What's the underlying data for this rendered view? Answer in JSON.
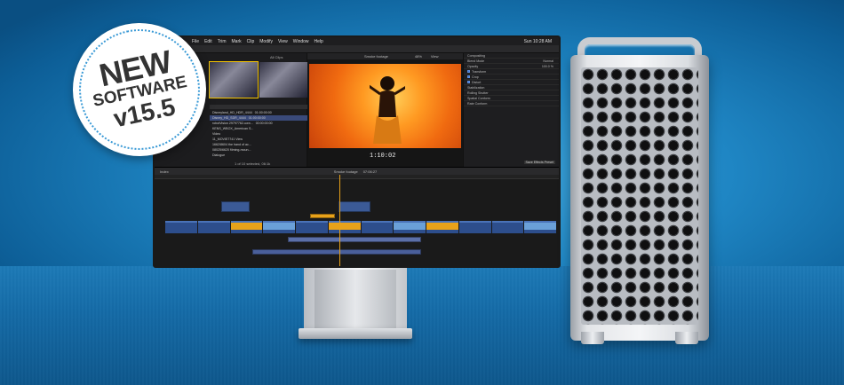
{
  "badge": {
    "line1": "NEW",
    "line2": "SOFTWARE",
    "line3": "v15.5"
  },
  "menu": {
    "items": [
      "File",
      "Edit",
      "Trim",
      "Mark",
      "Clip",
      "Modify",
      "View",
      "Window",
      "Help"
    ],
    "clock": "Sun 10:28 AM"
  },
  "browser": {
    "filter": "All Clips",
    "clips": [
      {
        "name": "Disneyland_HD_HDR_4444",
        "start": "01:00:00:00",
        "end": "01:00:0"
      },
      {
        "name": "Disney_HD_SDR_4444",
        "start": "01:00:00:00",
        "end": "01:00:0"
      },
      {
        "name": "robotVision 29797762-uwn...",
        "start": "00:00:00:00",
        "end": "00:00:0"
      },
      {
        "name": "KENS_WBOX_American S...",
        "start": "00:00:00:00",
        "end": "00:00:0"
      },
      {
        "name": "Video",
        "start": "",
        "end": ""
      },
      {
        "name": "11_MOVIE7741 View",
        "start": "00:00:00:00",
        "end": "00:00:0"
      },
      {
        "name": "1662/8604 the hand of ac...",
        "start": "00:00:00:00",
        "end": "00:00:0"
      },
      {
        "name": "08025/6620 filming-moun...",
        "start": "00:00:00:00",
        "end": "00:00:0"
      },
      {
        "name": "Dialogue",
        "start": "",
        "end": ""
      }
    ],
    "status": "1 of 10 selected, 06:1k"
  },
  "viewer": {
    "clip": "Smoke footage",
    "zoom": "48%",
    "view": "View",
    "timecode": "1:10:02"
  },
  "inspector": {
    "title": "Compositing",
    "rows": [
      "Blend Mode",
      "Opacity",
      "Transform",
      "Crop",
      "Distort",
      "Stabilization",
      "Rolling Shutter",
      "Spatial Conform",
      "Rate Conform"
    ],
    "blend": "Normal",
    "opacity": "100.0 %",
    "save_button": "Save Effects Preset"
  },
  "timeline": {
    "index": "Index",
    "project": "Smoke footage",
    "duration": "07:06:27"
  }
}
